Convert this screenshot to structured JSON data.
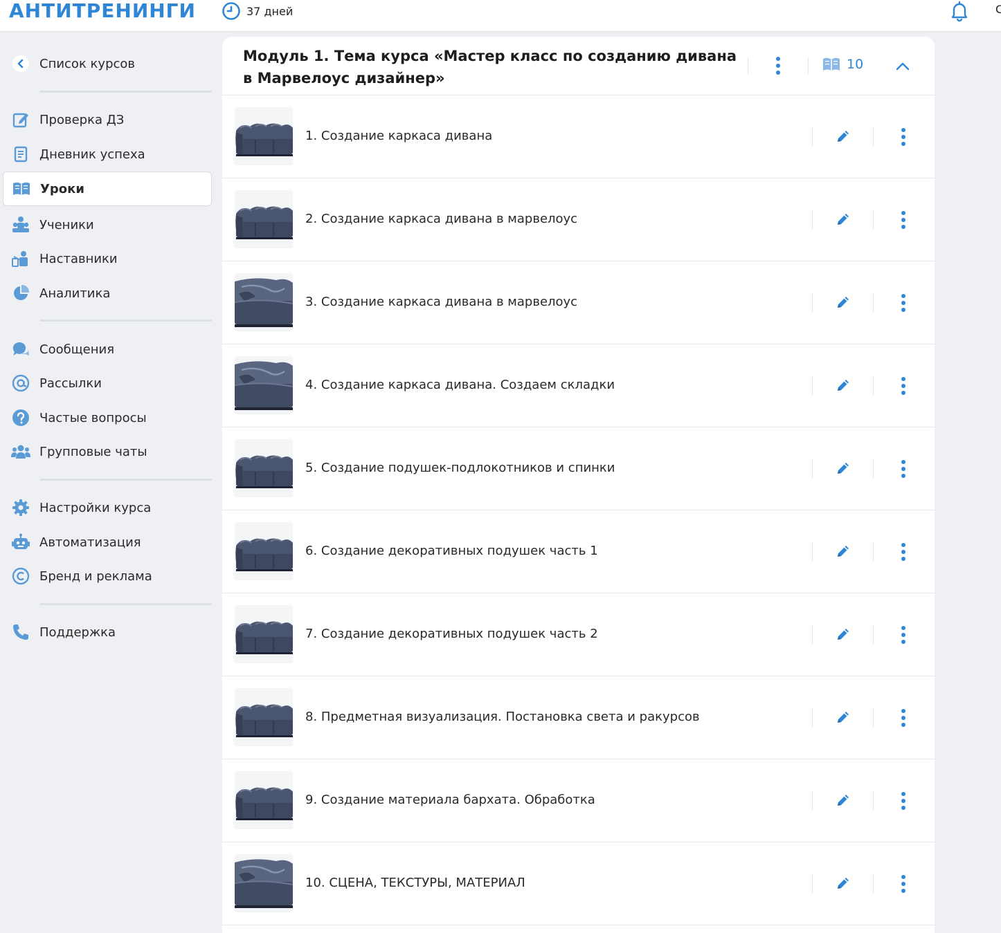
{
  "header": {
    "logo": "АНТИТРЕНИНГИ",
    "trial_text": "37 дней",
    "edge_char": "С"
  },
  "sidebar": {
    "back_label": "Список курсов",
    "groups": [
      [
        {
          "label": "Проверка ДЗ",
          "icon": "edit-note-icon"
        },
        {
          "label": "Дневник успеха",
          "icon": "document-icon"
        },
        {
          "label": "Уроки",
          "icon": "book-icon",
          "active": true
        },
        {
          "label": "Ученики",
          "icon": "students-icon"
        },
        {
          "label": "Наставники",
          "icon": "mentors-icon"
        },
        {
          "label": "Аналитика",
          "icon": "pie-chart-icon"
        }
      ],
      [
        {
          "label": "Сообщения",
          "icon": "messages-icon"
        },
        {
          "label": "Рассылки",
          "icon": "at-sign-icon"
        },
        {
          "label": "Частые вопросы",
          "icon": "question-icon"
        },
        {
          "label": "Групповые чаты",
          "icon": "group-chat-icon"
        }
      ],
      [
        {
          "label": "Настройки курса",
          "icon": "gear-icon"
        },
        {
          "label": "Автоматизация",
          "icon": "robot-icon"
        },
        {
          "label": "Бренд и реклама",
          "icon": "copyright-icon"
        }
      ],
      [
        {
          "label": "Поддержка",
          "icon": "phone-icon"
        }
      ]
    ]
  },
  "module": {
    "title": "Модуль 1. Тема курса «Мастер класс по созданию дивана в Марвелоус дизайнер»",
    "lessons_count": "10",
    "lessons": [
      {
        "title": "1. Создание каркаса дивана"
      },
      {
        "title": "2. Создание каркаса дивана в марвелоус"
      },
      {
        "title": "3. Создание каркаса дивана в марвелоус"
      },
      {
        "title": "4. Создание каркаса дивана. Создаем складки"
      },
      {
        "title": "5. Создание подушек-подлокотников и спинки"
      },
      {
        "title": "6. Создание декоративных подушек часть 1"
      },
      {
        "title": "7. Создание декоративных подушек часть 2"
      },
      {
        "title": "8. Предметная визуализация. Постановка света и ракурсов"
      },
      {
        "title": "9. Создание материала бархата. Обработка"
      },
      {
        "title": "10. СЦЕНА, ТЕКСТУРЫ, МАТЕРИАЛ"
      }
    ]
  },
  "colors": {
    "accent": "#2f86d6",
    "icon": "#5b9bd5",
    "background": "#eef0f3"
  }
}
